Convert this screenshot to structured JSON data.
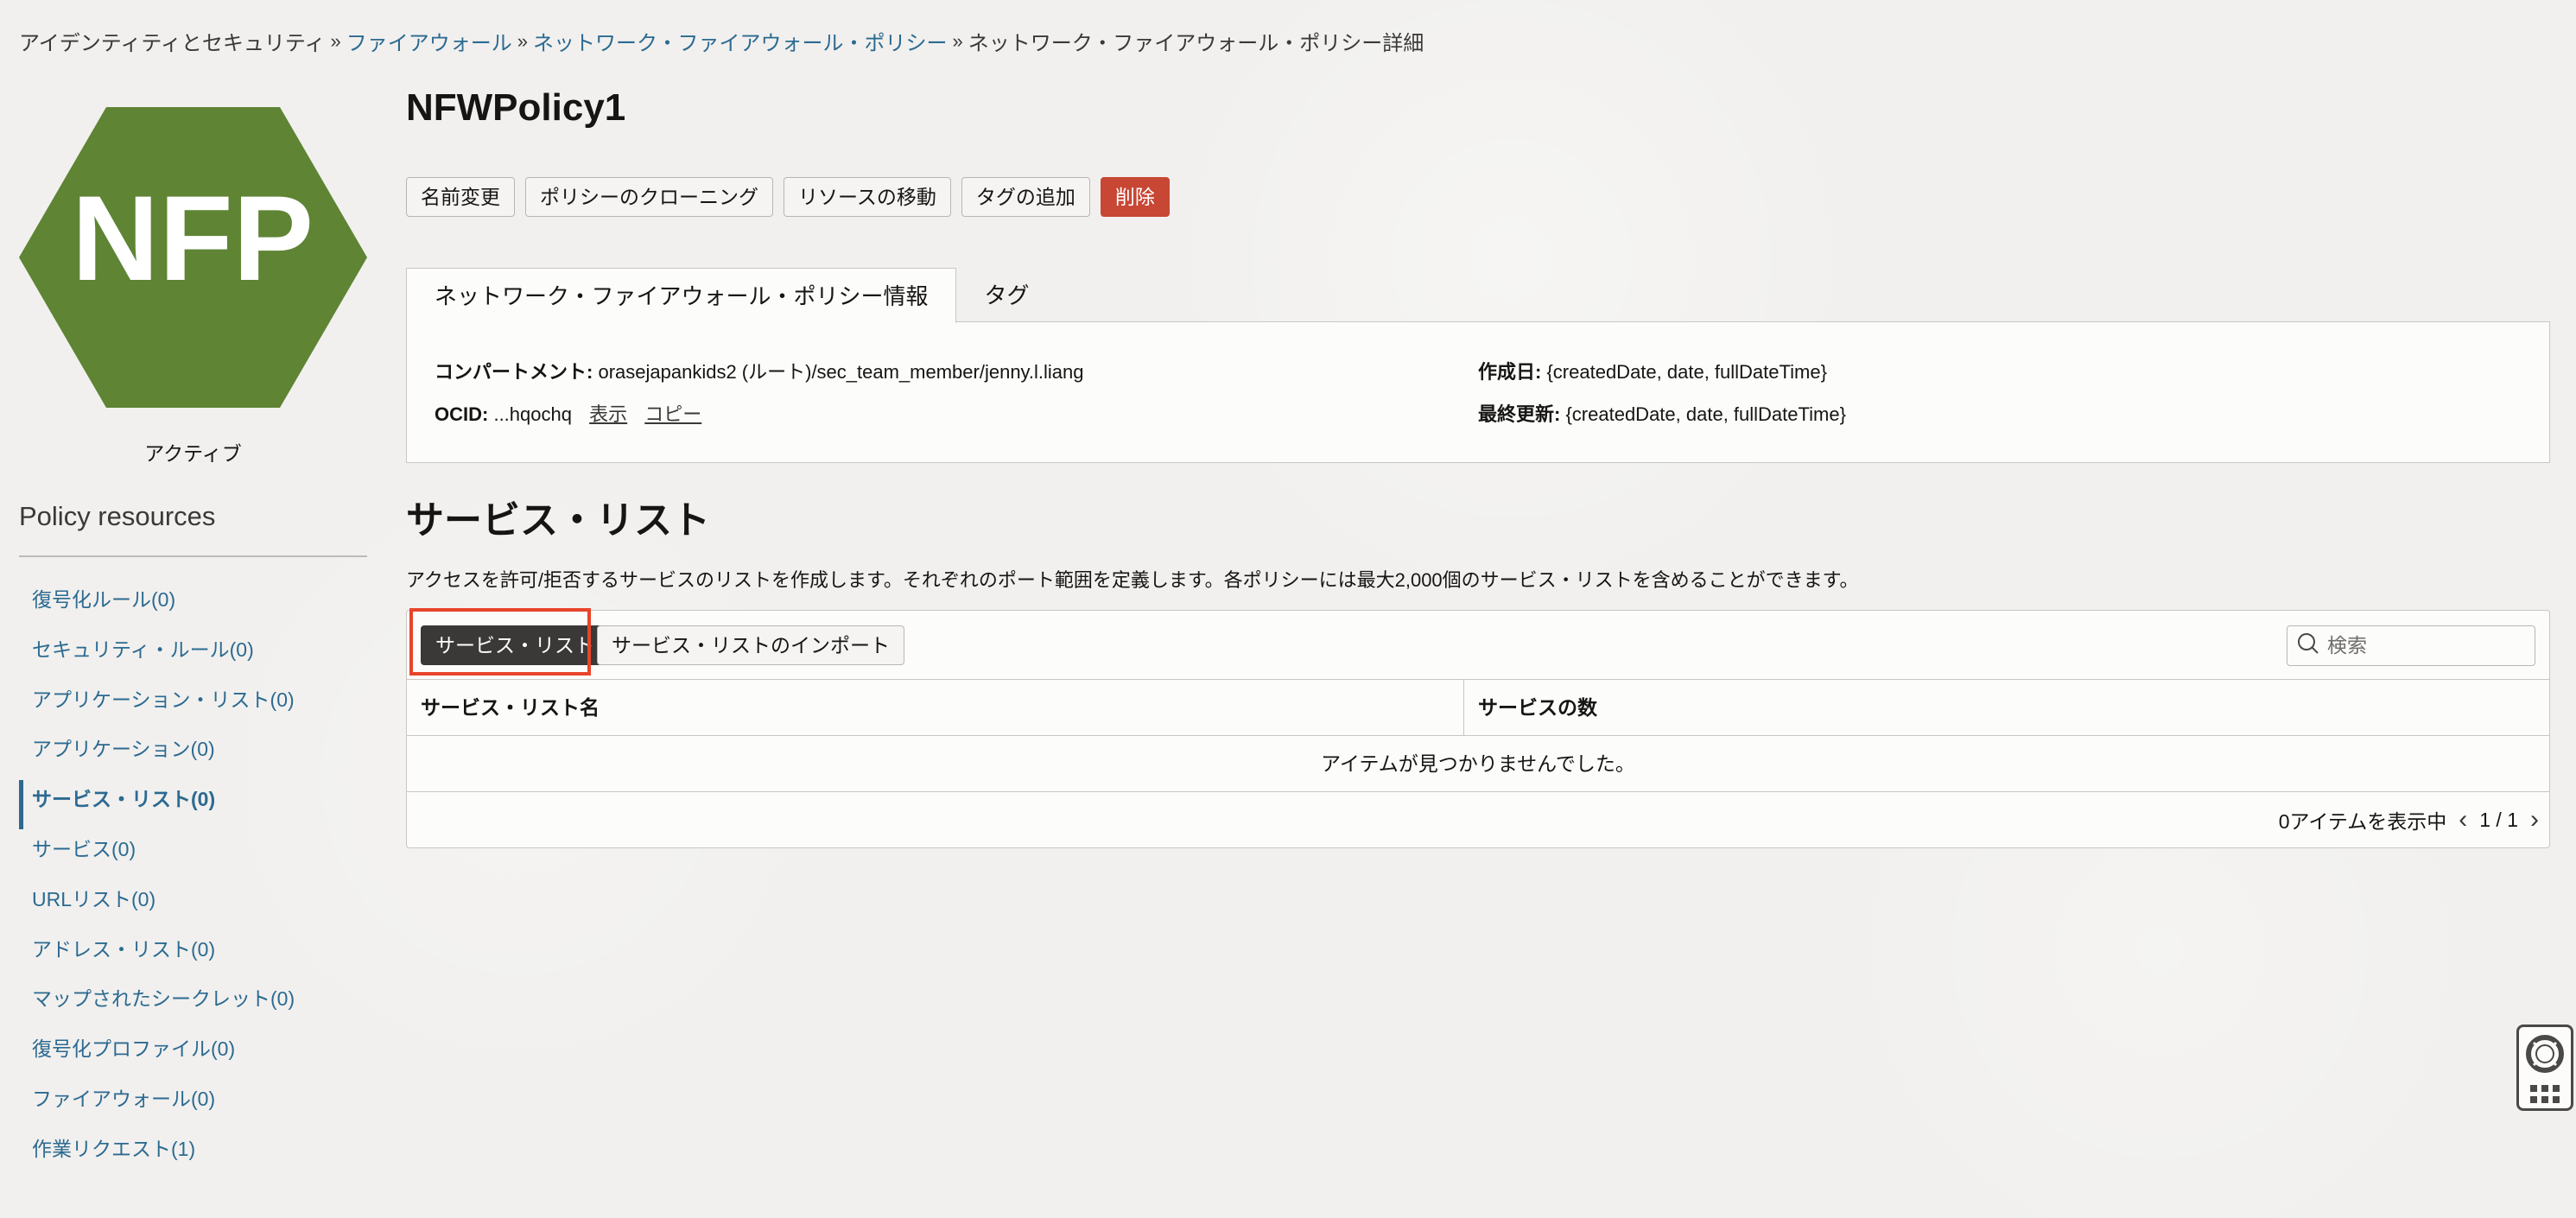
{
  "breadcrumb": {
    "items": [
      {
        "label": "アイデンティティとセキュリティ",
        "link": false
      },
      {
        "label": "ファイアウォール",
        "link": true
      },
      {
        "label": "ネットワーク・ファイアウォール・ポリシー",
        "link": true
      },
      {
        "label": "ネットワーク・ファイアウォール・ポリシー詳細",
        "link": false
      }
    ],
    "separator": "»"
  },
  "resource_icon": {
    "text": "NFP",
    "color": "#5e8434"
  },
  "status": "アクティブ",
  "sidebar": {
    "title": "Policy resources",
    "items": [
      {
        "label": "復号化ルール(0)",
        "active": false
      },
      {
        "label": "セキュリティ・ルール(0)",
        "active": false
      },
      {
        "label": "アプリケーション・リスト(0)",
        "active": false
      },
      {
        "label": "アプリケーション(0)",
        "active": false
      },
      {
        "label": "サービス・リスト(0)",
        "active": true
      },
      {
        "label": "サービス(0)",
        "active": false
      },
      {
        "label": "URLリスト(0)",
        "active": false
      },
      {
        "label": "アドレス・リスト(0)",
        "active": false
      },
      {
        "label": "マップされたシークレット(0)",
        "active": false
      },
      {
        "label": "復号化プロファイル(0)",
        "active": false
      },
      {
        "label": "ファイアウォール(0)",
        "active": false
      },
      {
        "label": "作業リクエスト(1)",
        "active": false
      }
    ]
  },
  "header": {
    "title": "NFWPolicy1",
    "actions": {
      "rename": "名前変更",
      "clone": "ポリシーのクローニング",
      "move": "リソースの移動",
      "add_tags": "タグの追加",
      "delete": "削除"
    }
  },
  "tabs": [
    {
      "label": "ネットワーク・ファイアウォール・ポリシー情報",
      "active": true
    },
    {
      "label": "タグ",
      "active": false
    }
  ],
  "info": {
    "compartment_label": "コンパートメント:",
    "compartment_value": "orasejapankids2 (ルート)/sec_team_member/jenny.l.liang",
    "ocid_label": "OCID:",
    "ocid_value": "...hqochq",
    "ocid_show": "表示",
    "ocid_copy": "コピー",
    "created_label": "作成日:",
    "created_value": "{createdDate, date, fullDateTime}",
    "updated_label": "最終更新:",
    "updated_value": "{createdDate, date, fullDateTime}"
  },
  "section": {
    "title": "サービス・リスト",
    "description": "アクセスを許可/拒否するサービスのリストを作成します。それぞれのポート範囲を定義します。各ポリシーには最大2,000個のサービス・リストを含めることができます。"
  },
  "toolbar": {
    "create_label": "サービス・リスト の作成",
    "import_label": "サービス・リストのインポート",
    "search_placeholder": "検索"
  },
  "table": {
    "columns": [
      "サービス・リスト名",
      "サービスの数"
    ],
    "rows": [],
    "empty_message": "アイテムが見つかりませんでした。",
    "footer_count": "0アイテムを表示中",
    "page": "1 / 1"
  },
  "colors": {
    "link": "#2c6a91",
    "danger": "#c74634",
    "primary_button": "#3a3937",
    "highlight": "#e8442b"
  }
}
